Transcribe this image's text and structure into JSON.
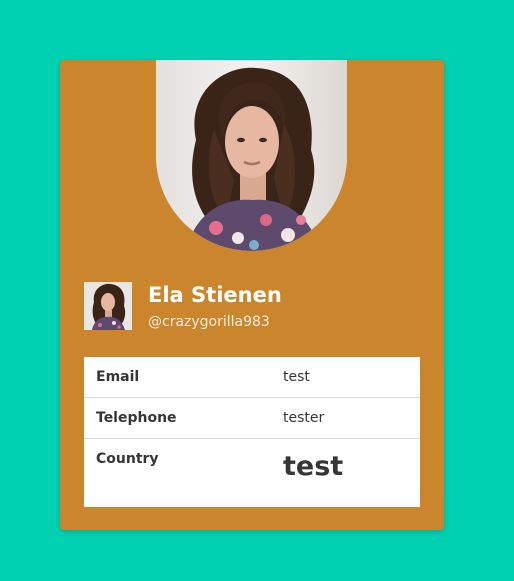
{
  "profile": {
    "name": "Ela Stienen",
    "handle": "@crazygorilla983"
  },
  "details": [
    {
      "label": "Email",
      "value": "test"
    },
    {
      "label": "Telephone",
      "value": "tester"
    },
    {
      "label": "Country",
      "value": "test"
    }
  ],
  "colors": {
    "page_background": "#00d1b2",
    "card_background": "#cb862d",
    "text_dark": "#363636"
  }
}
